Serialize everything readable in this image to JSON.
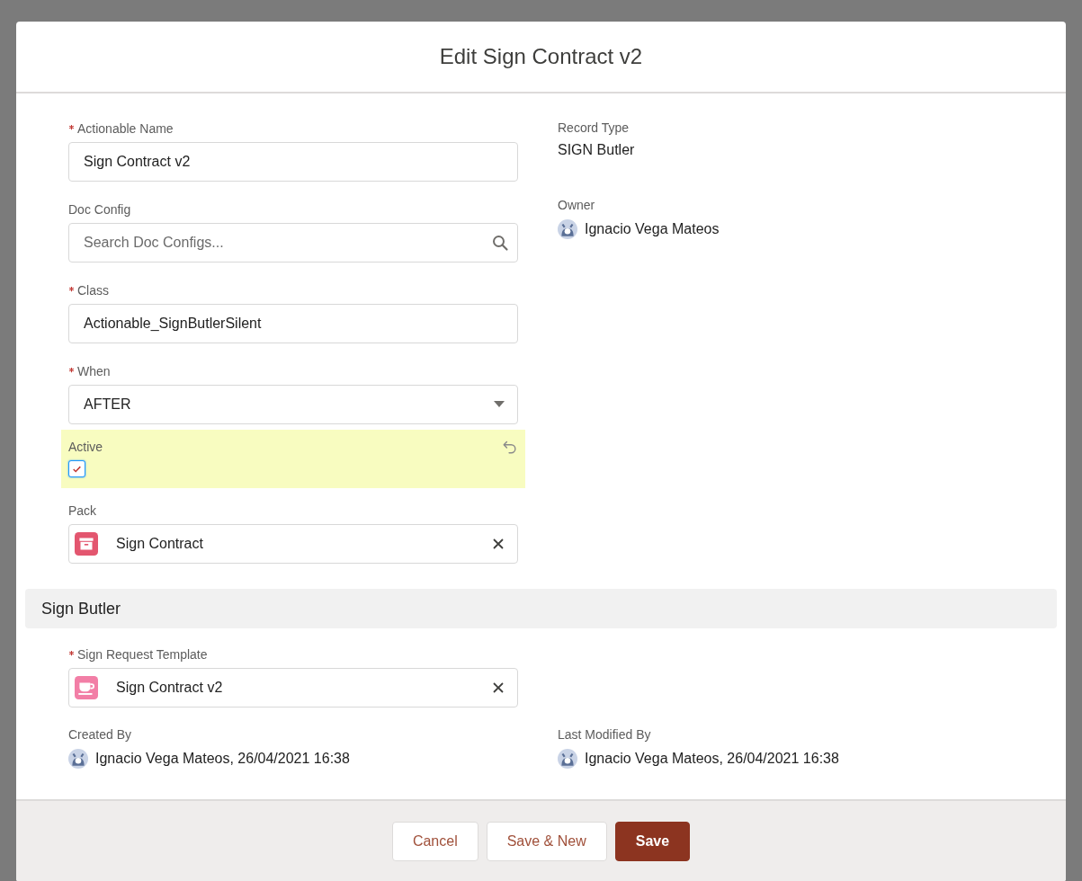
{
  "modal": {
    "title": "Edit Sign Contract v2"
  },
  "main_section": {
    "left_fields": [
      {
        "kind": "text",
        "label": "Actionable Name",
        "required": true,
        "value": "Sign Contract v2"
      },
      {
        "kind": "search",
        "label": "Doc Config",
        "required": false,
        "placeholder": "Search Doc Configs..."
      },
      {
        "kind": "text",
        "label": "Class",
        "required": true,
        "value": "Actionable_SignButlerSilent"
      },
      {
        "kind": "select",
        "label": "When",
        "required": true,
        "value": "AFTER"
      },
      {
        "kind": "checkbox",
        "label": "Active",
        "required": false,
        "checked": true,
        "edited": true
      },
      {
        "kind": "lookup",
        "label": "Pack",
        "required": false,
        "value": "Sign Contract"
      }
    ],
    "right_fields": [
      {
        "kind": "readonly",
        "label": "Record Type",
        "value": "SIGN Butler"
      },
      {
        "kind": "user",
        "label": "Owner",
        "value": "Ignacio Vega Mateos"
      }
    ]
  },
  "sign_butler_section": {
    "title": "Sign Butler",
    "fields": [
      {
        "kind": "lookup",
        "label": "Sign Request Template",
        "required": true,
        "value": "Sign Contract v2"
      }
    ],
    "audit": [
      {
        "kind": "user",
        "label": "Created By",
        "value": "Ignacio Vega Mateos, 26/04/2021 16:38"
      },
      {
        "kind": "user",
        "label": "Last Modified By",
        "value": "Ignacio Vega Mateos, 26/04/2021 16:38"
      }
    ]
  },
  "buttons": [
    {
      "label": "Cancel",
      "kind": "neutral"
    },
    {
      "label": "Save & New",
      "kind": "neutral"
    },
    {
      "label": "Save",
      "kind": "brand"
    }
  ]
}
